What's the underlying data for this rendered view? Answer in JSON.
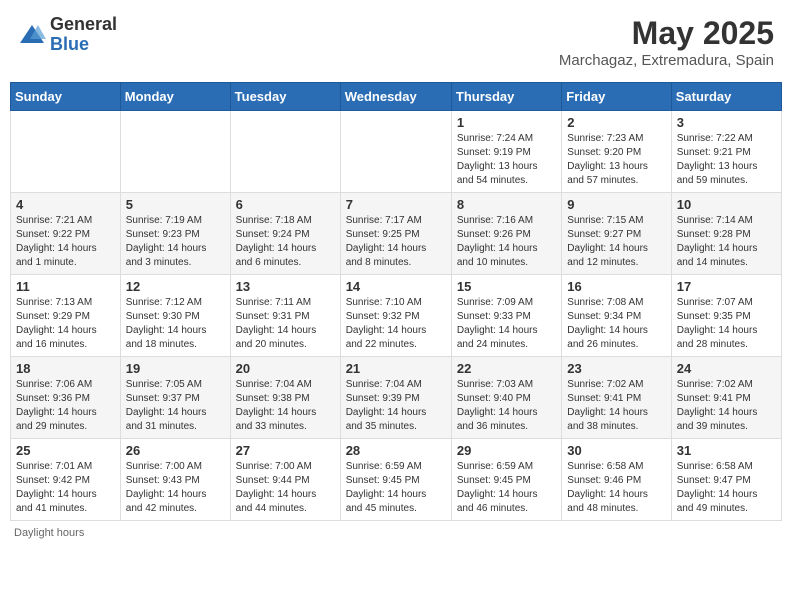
{
  "header": {
    "logo": {
      "general": "General",
      "blue": "Blue"
    },
    "title": "May 2025",
    "location": "Marchagaz, Extremadura, Spain"
  },
  "days_of_week": [
    "Sunday",
    "Monday",
    "Tuesday",
    "Wednesday",
    "Thursday",
    "Friday",
    "Saturday"
  ],
  "weeks": [
    [
      {
        "day": "",
        "info": ""
      },
      {
        "day": "",
        "info": ""
      },
      {
        "day": "",
        "info": ""
      },
      {
        "day": "",
        "info": ""
      },
      {
        "day": "1",
        "info": "Sunrise: 7:24 AM\nSunset: 9:19 PM\nDaylight: 13 hours\nand 54 minutes."
      },
      {
        "day": "2",
        "info": "Sunrise: 7:23 AM\nSunset: 9:20 PM\nDaylight: 13 hours\nand 57 minutes."
      },
      {
        "day": "3",
        "info": "Sunrise: 7:22 AM\nSunset: 9:21 PM\nDaylight: 13 hours\nand 59 minutes."
      }
    ],
    [
      {
        "day": "4",
        "info": "Sunrise: 7:21 AM\nSunset: 9:22 PM\nDaylight: 14 hours\nand 1 minute."
      },
      {
        "day": "5",
        "info": "Sunrise: 7:19 AM\nSunset: 9:23 PM\nDaylight: 14 hours\nand 3 minutes."
      },
      {
        "day": "6",
        "info": "Sunrise: 7:18 AM\nSunset: 9:24 PM\nDaylight: 14 hours\nand 6 minutes."
      },
      {
        "day": "7",
        "info": "Sunrise: 7:17 AM\nSunset: 9:25 PM\nDaylight: 14 hours\nand 8 minutes."
      },
      {
        "day": "8",
        "info": "Sunrise: 7:16 AM\nSunset: 9:26 PM\nDaylight: 14 hours\nand 10 minutes."
      },
      {
        "day": "9",
        "info": "Sunrise: 7:15 AM\nSunset: 9:27 PM\nDaylight: 14 hours\nand 12 minutes."
      },
      {
        "day": "10",
        "info": "Sunrise: 7:14 AM\nSunset: 9:28 PM\nDaylight: 14 hours\nand 14 minutes."
      }
    ],
    [
      {
        "day": "11",
        "info": "Sunrise: 7:13 AM\nSunset: 9:29 PM\nDaylight: 14 hours\nand 16 minutes."
      },
      {
        "day": "12",
        "info": "Sunrise: 7:12 AM\nSunset: 9:30 PM\nDaylight: 14 hours\nand 18 minutes."
      },
      {
        "day": "13",
        "info": "Sunrise: 7:11 AM\nSunset: 9:31 PM\nDaylight: 14 hours\nand 20 minutes."
      },
      {
        "day": "14",
        "info": "Sunrise: 7:10 AM\nSunset: 9:32 PM\nDaylight: 14 hours\nand 22 minutes."
      },
      {
        "day": "15",
        "info": "Sunrise: 7:09 AM\nSunset: 9:33 PM\nDaylight: 14 hours\nand 24 minutes."
      },
      {
        "day": "16",
        "info": "Sunrise: 7:08 AM\nSunset: 9:34 PM\nDaylight: 14 hours\nand 26 minutes."
      },
      {
        "day": "17",
        "info": "Sunrise: 7:07 AM\nSunset: 9:35 PM\nDaylight: 14 hours\nand 28 minutes."
      }
    ],
    [
      {
        "day": "18",
        "info": "Sunrise: 7:06 AM\nSunset: 9:36 PM\nDaylight: 14 hours\nand 29 minutes."
      },
      {
        "day": "19",
        "info": "Sunrise: 7:05 AM\nSunset: 9:37 PM\nDaylight: 14 hours\nand 31 minutes."
      },
      {
        "day": "20",
        "info": "Sunrise: 7:04 AM\nSunset: 9:38 PM\nDaylight: 14 hours\nand 33 minutes."
      },
      {
        "day": "21",
        "info": "Sunrise: 7:04 AM\nSunset: 9:39 PM\nDaylight: 14 hours\nand 35 minutes."
      },
      {
        "day": "22",
        "info": "Sunrise: 7:03 AM\nSunset: 9:40 PM\nDaylight: 14 hours\nand 36 minutes."
      },
      {
        "day": "23",
        "info": "Sunrise: 7:02 AM\nSunset: 9:41 PM\nDaylight: 14 hours\nand 38 minutes."
      },
      {
        "day": "24",
        "info": "Sunrise: 7:02 AM\nSunset: 9:41 PM\nDaylight: 14 hours\nand 39 minutes."
      }
    ],
    [
      {
        "day": "25",
        "info": "Sunrise: 7:01 AM\nSunset: 9:42 PM\nDaylight: 14 hours\nand 41 minutes."
      },
      {
        "day": "26",
        "info": "Sunrise: 7:00 AM\nSunset: 9:43 PM\nDaylight: 14 hours\nand 42 minutes."
      },
      {
        "day": "27",
        "info": "Sunrise: 7:00 AM\nSunset: 9:44 PM\nDaylight: 14 hours\nand 44 minutes."
      },
      {
        "day": "28",
        "info": "Sunrise: 6:59 AM\nSunset: 9:45 PM\nDaylight: 14 hours\nand 45 minutes."
      },
      {
        "day": "29",
        "info": "Sunrise: 6:59 AM\nSunset: 9:45 PM\nDaylight: 14 hours\nand 46 minutes."
      },
      {
        "day": "30",
        "info": "Sunrise: 6:58 AM\nSunset: 9:46 PM\nDaylight: 14 hours\nand 48 minutes."
      },
      {
        "day": "31",
        "info": "Sunrise: 6:58 AM\nSunset: 9:47 PM\nDaylight: 14 hours\nand 49 minutes."
      }
    ]
  ],
  "footer": {
    "note": "Daylight hours"
  }
}
